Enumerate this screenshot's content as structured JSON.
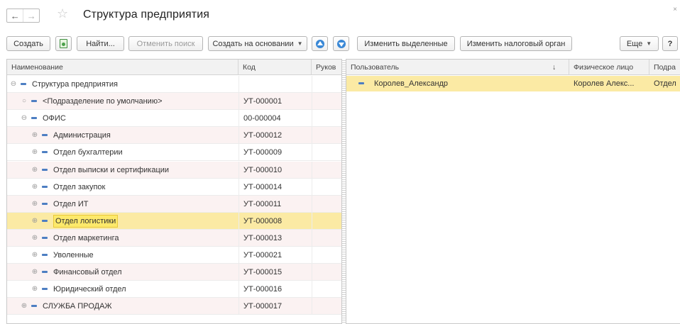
{
  "window": {
    "title": "Структура предприятия",
    "close_glyph": "×",
    "nav_back_icon": "arrow-left-icon",
    "nav_forward_icon": "arrow-right-icon",
    "favorite_icon": "star-icon"
  },
  "toolbar": {
    "create": "Создать",
    "find": "Найти...",
    "cancel_search": "Отменить поиск",
    "create_based_on": "Создать на основании",
    "edit_selected": "Изменить выделенные",
    "edit_tax_authority": "Изменить налоговый орган",
    "more": "Еще",
    "help": "?"
  },
  "left_table": {
    "columns": [
      "Наименование",
      "Код",
      "Руков"
    ],
    "rows": [
      {
        "name": "Структура предприятия",
        "code": "",
        "expander": "⊖"
      },
      {
        "name": "<Подразделение по умолчанию>",
        "code": "УТ-000001",
        "expander": "○"
      },
      {
        "name": "ОФИС",
        "code": "00-000004",
        "expander": "⊖"
      },
      {
        "name": "Администрация",
        "code": "УТ-000012",
        "expander": "⊕"
      },
      {
        "name": "Отдел бухгалтерии",
        "code": "УТ-000009",
        "expander": "⊕"
      },
      {
        "name": "Отдел выписки и сертификации",
        "code": "УТ-000010",
        "expander": "⊕"
      },
      {
        "name": "Отдел закупок",
        "code": "УТ-000014",
        "expander": "⊕"
      },
      {
        "name": "Отдел ИТ",
        "code": "УТ-000011",
        "expander": "⊕"
      },
      {
        "name": "Отдел логистики",
        "code": "УТ-000008",
        "expander": "⊕"
      },
      {
        "name": "Отдел маркетинга",
        "code": "УТ-000013",
        "expander": "⊕"
      },
      {
        "name": "Уволенные",
        "code": "УТ-000021",
        "expander": "⊕"
      },
      {
        "name": "Финансовый отдел",
        "code": "УТ-000015",
        "expander": "⊕"
      },
      {
        "name": "Юридический отдел",
        "code": "УТ-000016",
        "expander": "⊕"
      },
      {
        "name": "СЛУЖБА ПРОДАЖ",
        "code": "УТ-000017",
        "expander": "⊕"
      }
    ],
    "selected_row": "Отдел логистики"
  },
  "right_table": {
    "columns": [
      "Пользователь",
      "Физическое лицо",
      "Подра"
    ],
    "sort_glyph": "↓",
    "rows": [
      {
        "user": "Королев_Александр",
        "person": "Королев Алекс...",
        "department": "Отдел"
      }
    ]
  },
  "colors": {
    "selection": "#fbeaa4",
    "highlight": "#fde96b",
    "alt_row": "#fbf2f2",
    "accent": "#3a88d6"
  }
}
